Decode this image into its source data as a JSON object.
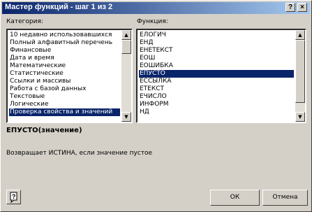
{
  "window": {
    "title": "Мастер функций - шаг 1 из 2",
    "help_label": "?",
    "close_label": "×"
  },
  "category": {
    "label": "Категория:",
    "items": [
      "10 недавно использовавшихся",
      "Полный алфавитный перечень",
      "Финансовые",
      "Дата и время",
      "Математические",
      "Статистические",
      "Ссылки и массивы",
      "Работа с базой данных",
      "Текстовые",
      "Логические",
      "Проверка свойства и значений"
    ],
    "selected_index": 10
  },
  "function": {
    "label": "Функция:",
    "items": [
      "ЕЛОГИЧ",
      "ЕНД",
      "ЕНЕТЕКСТ",
      "ЕОШ",
      "ЕОШИБКА",
      "ЕПУСТО",
      "ЕССЫЛКА",
      "ЕТЕКСТ",
      "ЕЧИСЛО",
      "ИНФОРМ",
      "НД"
    ],
    "selected_index": 5
  },
  "syntax": "ЕПУСТО(значение)",
  "description": "Возвращает ИСТИНА, если значение пустое",
  "buttons": {
    "ok": "ОК",
    "cancel": "Отмена"
  }
}
